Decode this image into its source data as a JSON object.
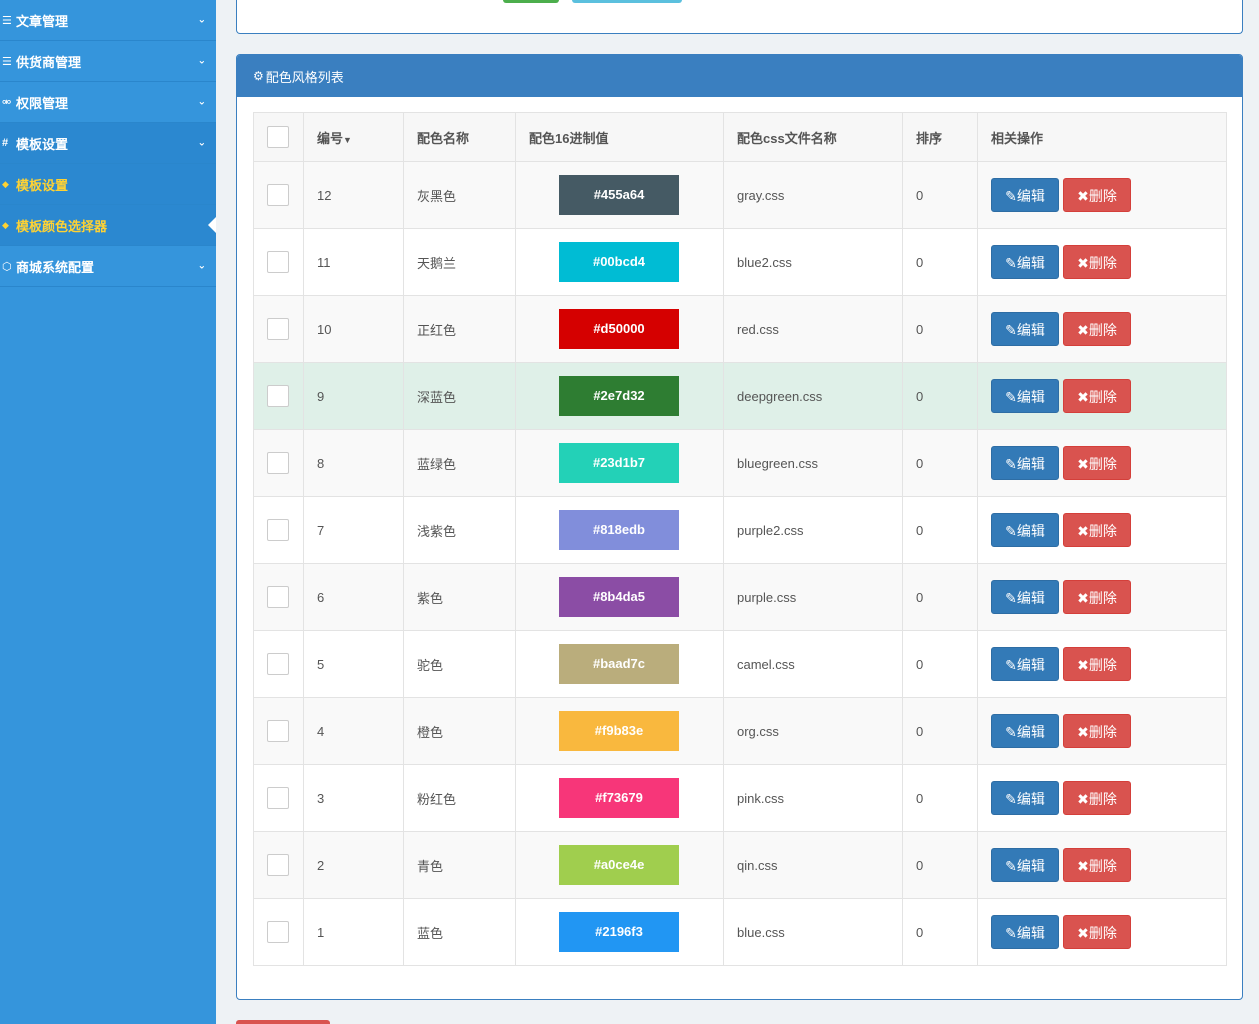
{
  "sidebar": {
    "items": [
      {
        "icon": "list-icon",
        "glyph": "☰",
        "label": "文章管理"
      },
      {
        "icon": "list-icon",
        "glyph": "☰",
        "label": "供货商管理"
      },
      {
        "icon": "unlock-icon",
        "glyph": "🔓",
        "label": "权限管理"
      },
      {
        "icon": "hash-icon",
        "glyph": "#",
        "label": "模板设置"
      },
      {
        "icon": "cube-icon",
        "glyph": "⬡",
        "label": "商城系统配置"
      }
    ],
    "subitems": [
      {
        "label": "模板设置"
      },
      {
        "label": "模板颜色选择器"
      }
    ]
  },
  "panel": {
    "title": "配色风格列表"
  },
  "table": {
    "headers": {
      "id": "编号",
      "name": "配色名称",
      "hex": "配色16进制值",
      "css": "配色css文件名称",
      "sort": "排序",
      "actions": "相关操作"
    },
    "edit_label": "编辑",
    "delete_label": "删除",
    "rows": [
      {
        "id": "12",
        "name": "灰黑色",
        "hex": "#455a64",
        "css": "gray.css",
        "sort": "0"
      },
      {
        "id": "11",
        "name": "天鹅兰",
        "hex": "#00bcd4",
        "css": "blue2.css",
        "sort": "0"
      },
      {
        "id": "10",
        "name": "正红色",
        "hex": "#d50000",
        "css": "red.css",
        "sort": "0"
      },
      {
        "id": "9",
        "name": "深蓝色",
        "hex": "#2e7d32",
        "css": "deepgreen.css",
        "sort": "0"
      },
      {
        "id": "8",
        "name": "蓝绿色",
        "hex": "#23d1b7",
        "css": "bluegreen.css",
        "sort": "0"
      },
      {
        "id": "7",
        "name": "浅紫色",
        "hex": "#818edb",
        "css": "purple2.css",
        "sort": "0"
      },
      {
        "id": "6",
        "name": "紫色",
        "hex": "#8b4da5",
        "css": "purple.css",
        "sort": "0"
      },
      {
        "id": "5",
        "name": "驼色",
        "hex": "#baad7c",
        "css": "camel.css",
        "sort": "0"
      },
      {
        "id": "4",
        "name": "橙色",
        "hex": "#f9b83e",
        "css": "org.css",
        "sort": "0"
      },
      {
        "id": "3",
        "name": "粉红色",
        "hex": "#f73679",
        "css": "pink.css",
        "sort": "0"
      },
      {
        "id": "2",
        "name": "青色",
        "hex": "#a0ce4e",
        "css": "qin.css",
        "sort": "0"
      },
      {
        "id": "1",
        "name": "蓝色",
        "hex": "#2196f3",
        "css": "blue.css",
        "sort": "0"
      }
    ]
  },
  "colors": {
    "sidebar_bg": "#3595dc",
    "panel_header": "#3a7fc0",
    "submenu_text": "#ffd233",
    "edit_button": "#337ab7",
    "delete_button": "#d9534f",
    "highlight_row": "#dff0e8"
  }
}
